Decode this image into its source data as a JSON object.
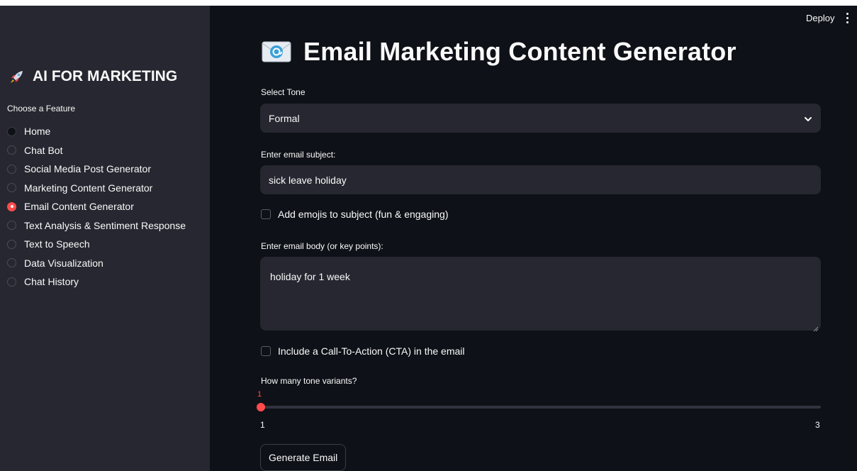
{
  "sidebar": {
    "title": "AI FOR MARKETING",
    "title_icon": "rocket-icon",
    "caption": "Choose a Feature",
    "items": [
      {
        "label": "Home",
        "selected": false
      },
      {
        "label": "Chat Bot",
        "selected": false
      },
      {
        "label": "Social Media Post Generator",
        "selected": false
      },
      {
        "label": "Marketing Content Generator",
        "selected": false
      },
      {
        "label": "Email Content Generator",
        "selected": true
      },
      {
        "label": "Text Analysis & Sentiment Response",
        "selected": false
      },
      {
        "label": "Text to Speech",
        "selected": false
      },
      {
        "label": "Data Visualization",
        "selected": false
      },
      {
        "label": "Chat History",
        "selected": false
      }
    ]
  },
  "header": {
    "deploy_label": "Deploy",
    "menu_icon": "kebab-menu-icon"
  },
  "main": {
    "title": "Email Marketing Content Generator",
    "title_icon": "envelope-email-icon",
    "tone": {
      "label": "Select Tone",
      "value": "Formal"
    },
    "subject": {
      "label": "Enter email subject:",
      "value": "sick leave holiday"
    },
    "emoji_checkbox": {
      "label": "Add emojis to subject (fun & engaging)",
      "checked": false
    },
    "body": {
      "label": "Enter email body (or key points):",
      "value": "holiday for 1 week"
    },
    "cta_checkbox": {
      "label": "Include a Call-To-Action (CTA) in the email",
      "checked": false
    },
    "variants": {
      "label": "How many tone variants?",
      "value": "1",
      "min": "1",
      "max": "3"
    },
    "generate_label": "Generate Email"
  },
  "colors": {
    "accent": "#ff4b4b",
    "sidebar_bg": "#262730",
    "main_bg": "#0e1117",
    "input_bg": "#262730",
    "text": "#fafafa"
  }
}
